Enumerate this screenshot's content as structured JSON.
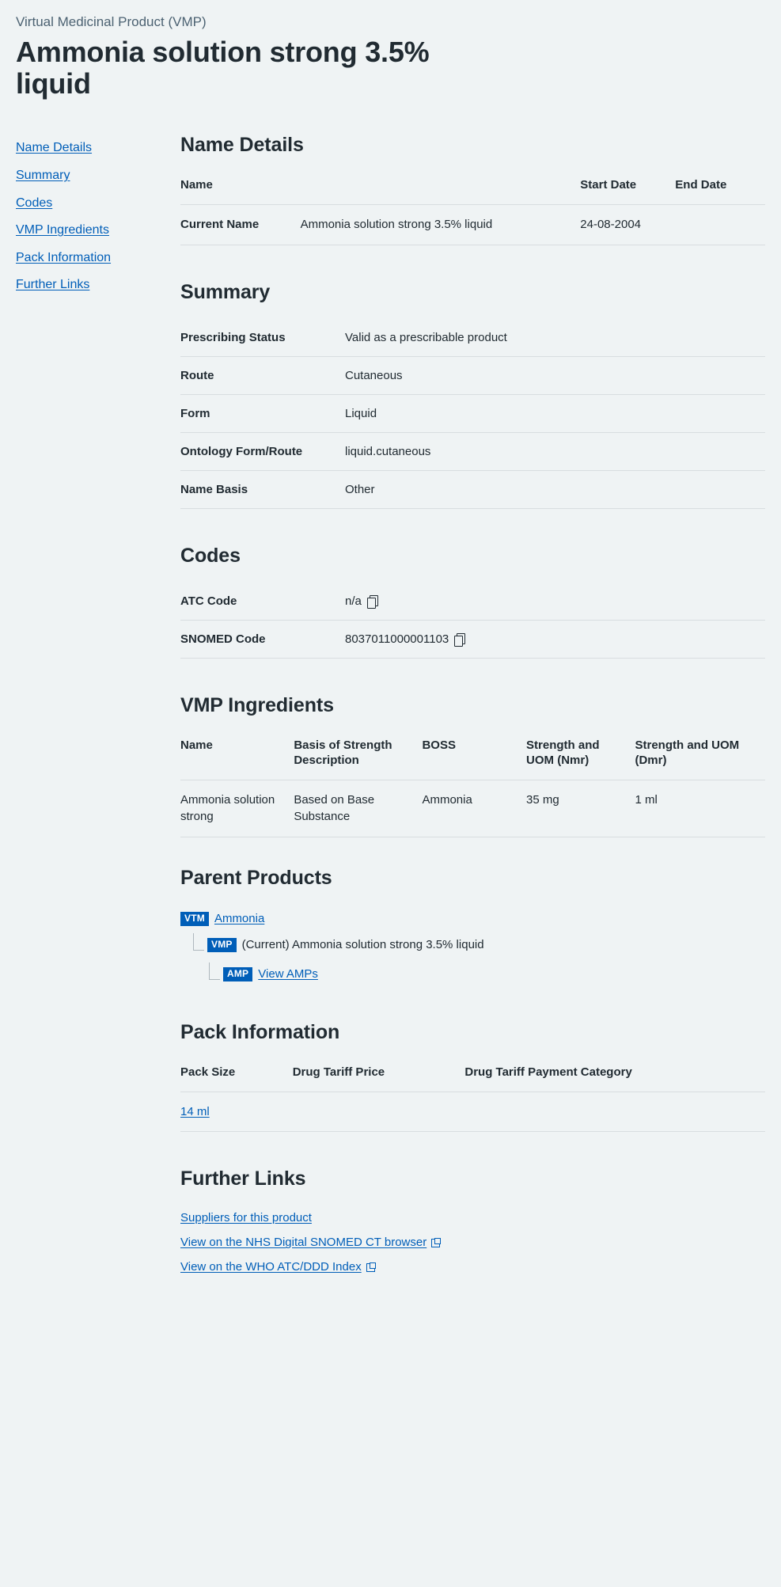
{
  "header": {
    "eyebrow": "Virtual Medicinal Product (VMP)",
    "title": "Ammonia solution strong 3.5% liquid"
  },
  "sidebar": {
    "items": [
      {
        "label": "Name Details"
      },
      {
        "label": "Summary"
      },
      {
        "label": "Codes"
      },
      {
        "label": "VMP Ingredients"
      },
      {
        "label": "Pack Information"
      },
      {
        "label": "Further Links"
      }
    ]
  },
  "name_details": {
    "heading": "Name Details",
    "columns": [
      "Name",
      "",
      "Start Date",
      "End Date"
    ],
    "rows": [
      {
        "label": "Current Name",
        "name": "Ammonia solution strong 3.5% liquid",
        "start_date": "24-08-2004",
        "end_date": ""
      }
    ]
  },
  "summary": {
    "heading": "Summary",
    "rows": [
      {
        "key": "Prescribing Status",
        "value": "Valid as a prescribable product"
      },
      {
        "key": "Route",
        "value": "Cutaneous"
      },
      {
        "key": "Form",
        "value": "Liquid"
      },
      {
        "key": "Ontology Form/Route",
        "value": "liquid.cutaneous"
      },
      {
        "key": "Name Basis",
        "value": "Other"
      }
    ]
  },
  "codes": {
    "heading": "Codes",
    "rows": [
      {
        "key": "ATC Code",
        "value": "n/a",
        "copy_icon": "copy-icon"
      },
      {
        "key": "SNOMED Code",
        "value": "8037011000001103",
        "copy_icon": "copy-icon"
      }
    ]
  },
  "ingredients": {
    "heading": "VMP Ingredients",
    "columns": [
      "Name",
      "Basis of Strength Description",
      "BOSS",
      "Strength and UOM (Nmr)",
      "Strength and UOM (Dmr)"
    ],
    "rows": [
      {
        "name": "Ammonia solution strong",
        "basis": "Based on Base Substance",
        "boss": "Ammonia",
        "nmr": "35 mg",
        "dmr": "1 ml"
      }
    ]
  },
  "parent_products": {
    "heading": "Parent Products",
    "nodes": [
      {
        "badge": "VTM",
        "label": "Ammonia",
        "is_link": true,
        "level": 1
      },
      {
        "badge": "VMP",
        "label": "(Current) Ammonia solution strong 3.5% liquid",
        "is_link": false,
        "level": 2
      },
      {
        "badge": "AMP",
        "label": "View AMPs",
        "is_link": true,
        "level": 3
      }
    ]
  },
  "pack_information": {
    "heading": "Pack Information",
    "columns": [
      "Pack Size",
      "Drug Tariff Price",
      "Drug Tariff Payment Category"
    ],
    "rows": [
      {
        "pack_size": "14 ml",
        "price": "",
        "category": ""
      }
    ]
  },
  "further_links": {
    "heading": "Further Links",
    "links": [
      {
        "label": "Suppliers for this product",
        "external": false
      },
      {
        "label": "View on the NHS Digital SNOMED CT browser",
        "external": true,
        "icon": "external-link-icon"
      },
      {
        "label": "View on the WHO ATC/DDD Index",
        "external": true,
        "icon": "external-link-icon"
      }
    ]
  },
  "theme": {
    "background": "#eff3f4",
    "link_color": "#005eb8",
    "text_color": "#212b32",
    "muted_text": "#4c6272",
    "border_color": "#d8dde0",
    "badge_bg": "#005eb8"
  }
}
